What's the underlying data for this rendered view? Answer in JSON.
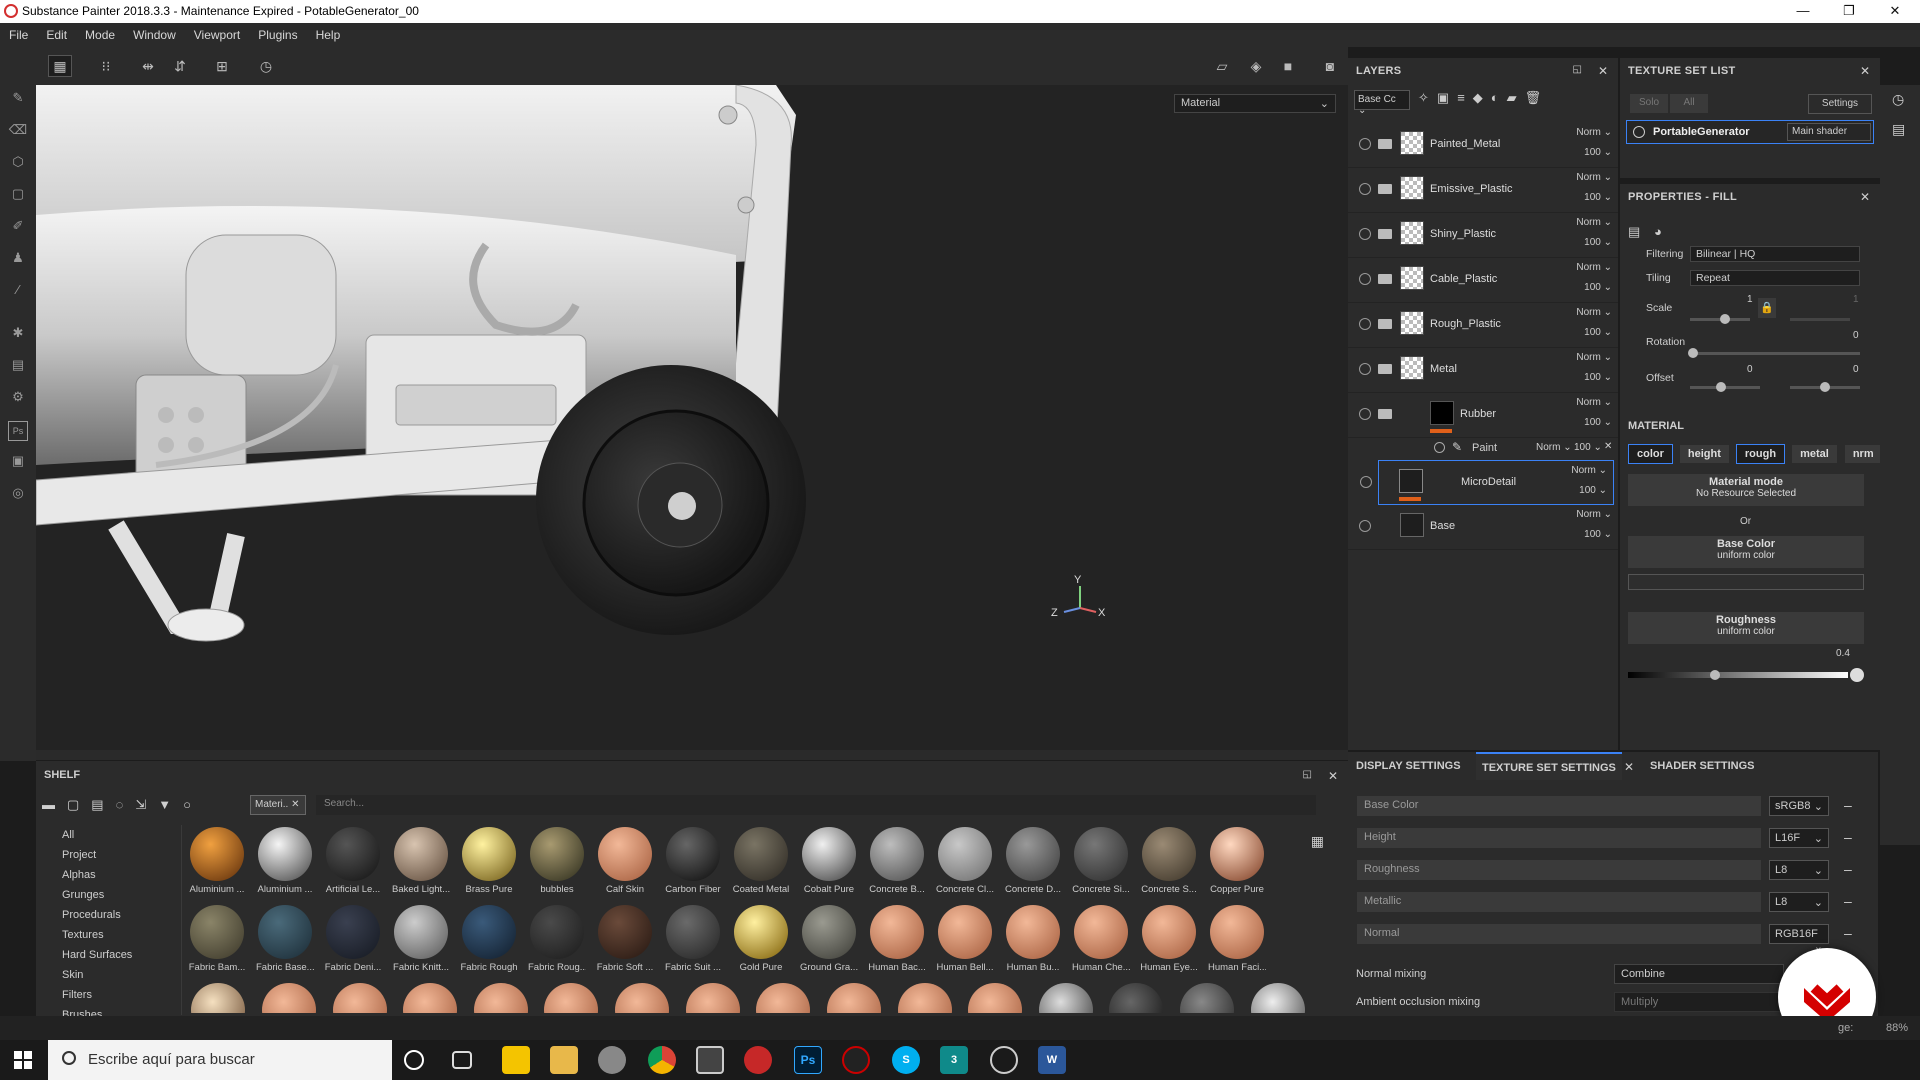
{
  "window": {
    "title": "Substance Painter 2018.3.3 - Maintenance Expired - PotableGenerator_00",
    "controls": [
      "—",
      "❐",
      "✕"
    ]
  },
  "menu": [
    "File",
    "Edit",
    "Mode",
    "Window",
    "Viewport",
    "Plugins",
    "Help"
  ],
  "viewport": {
    "material_select": "Material",
    "axis": {
      "y": "Y",
      "z": "Z",
      "x": "X"
    }
  },
  "layers": {
    "title": "LAYERS",
    "channel": "Base Cc",
    "items": [
      {
        "name": "Painted_Metal",
        "blend": "Norm",
        "opacity": "100"
      },
      {
        "name": "Emissive_Plastic",
        "blend": "Norm",
        "opacity": "100"
      },
      {
        "name": "Shiny_Plastic",
        "blend": "Norm",
        "opacity": "100"
      },
      {
        "name": "Cable_Plastic",
        "blend": "Norm",
        "opacity": "100"
      },
      {
        "name": "Rough_Plastic",
        "blend": "Norm",
        "opacity": "100"
      },
      {
        "name": "Metal",
        "blend": "Norm",
        "opacity": "100"
      },
      {
        "name": "Rubber",
        "blend": "Norm",
        "opacity": "100"
      }
    ],
    "paint": {
      "name": "Paint",
      "blend": "Norm",
      "opacity": "100"
    },
    "microdetail": {
      "name": "MicroDetail",
      "blend": "Norm",
      "opacity": "100"
    },
    "base": {
      "name": "Base",
      "blend": "Norm",
      "opacity": "100"
    }
  },
  "texture_set_list": {
    "title": "TEXTURE SET LIST",
    "solo": "Solo",
    "all": "All",
    "settings": "Settings",
    "set_name": "PortableGenerator",
    "shader": "Main shader"
  },
  "properties": {
    "title": "PROPERTIES - FILL",
    "filtering_label": "Filtering",
    "filtering": "Bilinear | HQ",
    "tiling_label": "Tiling",
    "tiling": "Repeat",
    "scale_label": "Scale",
    "scale_val": "1",
    "scale_val2": "1",
    "rotation_label": "Rotation",
    "rotation_val": "0",
    "offset_label": "Offset",
    "offset_val1": "0",
    "offset_val2": "0",
    "material_title": "MATERIAL",
    "channels": [
      "color",
      "height",
      "rough",
      "metal",
      "nrm"
    ],
    "material_mode": "Material mode",
    "no_resource": "No Resource Selected",
    "or": "Or",
    "base_color": "Base Color",
    "uniform1": "uniform color",
    "roughness": "Roughness",
    "uniform2": "uniform color",
    "rough_value": "0.4"
  },
  "bottom_tabs": [
    "DISPLAY SETTINGS",
    "TEXTURE SET SETTINGS",
    "SHADER SETTINGS"
  ],
  "texset": {
    "rows": [
      {
        "name": "Base Color",
        "fmt": "sRGB8"
      },
      {
        "name": "Height",
        "fmt": "L16F"
      },
      {
        "name": "Roughness",
        "fmt": "L8"
      },
      {
        "name": "Metallic",
        "fmt": "L8"
      },
      {
        "name": "Normal",
        "fmt": "RGB16F"
      }
    ],
    "normal_mixing_label": "Normal mixing",
    "normal_mixing": "Combine",
    "ao_label": "Ambient occlusion mixing",
    "ao": "Multiply"
  },
  "shelf": {
    "title": "SHELF",
    "filter_chip": "Materi..",
    "search_placeholder": "Search...",
    "categories": [
      "All",
      "Project",
      "Alphas",
      "Grunges",
      "Procedurals",
      "Textures",
      "Hard Surfaces",
      "Skin",
      "Filters",
      "Brushes"
    ],
    "row1": [
      {
        "name": "Aluminium ...",
        "c1": "#f0a040",
        "c2": "#5a2a08"
      },
      {
        "name": "Aluminium ...",
        "c1": "#f5f5f5",
        "c2": "#404040"
      },
      {
        "name": "Artificial Le...",
        "c1": "#555",
        "c2": "#111"
      },
      {
        "name": "Baked Light...",
        "c1": "#d8c4b0",
        "c2": "#5a4636"
      },
      {
        "name": "Brass Pure",
        "c1": "#fff2a0",
        "c2": "#6a5410"
      },
      {
        "name": "bubbles",
        "c1": "#a89a70",
        "c2": "#2a2a1a"
      },
      {
        "name": "Calf Skin",
        "c1": "#f2b898",
        "c2": "#a25a3a"
      },
      {
        "name": "Carbon Fiber",
        "c1": "#666",
        "c2": "#0a0a0a"
      },
      {
        "name": "Coated Metal",
        "c1": "#7a7464",
        "c2": "#2a2620"
      },
      {
        "name": "Cobalt Pure",
        "c1": "#f0f0f0",
        "c2": "#3a3a3a"
      },
      {
        "name": "Concrete B...",
        "c1": "#bdbdbd",
        "c2": "#4a4a4a"
      },
      {
        "name": "Concrete Cl...",
        "c1": "#c8c8c8",
        "c2": "#6a6a6a"
      },
      {
        "name": "Concrete D...",
        "c1": "#999",
        "c2": "#3a3a3a"
      },
      {
        "name": "Concrete Si...",
        "c1": "#777",
        "c2": "#2a2a2a"
      },
      {
        "name": "Concrete S...",
        "c1": "#9a8a74",
        "c2": "#3a3226"
      },
      {
        "name": "Copper Pure",
        "c1": "#ffd8c0",
        "c2": "#7a3a20"
      }
    ],
    "row2": [
      {
        "name": "Fabric Bam...",
        "c1": "#8a8468",
        "c2": "#3a3628"
      },
      {
        "name": "Fabric Base...",
        "c1": "#4a6a7a",
        "c2": "#1a2a34"
      },
      {
        "name": "Fabric Deni...",
        "c1": "#3a4050",
        "c2": "#141820"
      },
      {
        "name": "Fabric Knitt...",
        "c1": "#ccc",
        "c2": "#555"
      },
      {
        "name": "Fabric Rough",
        "c1": "#3a5a7a",
        "c2": "#101c2a"
      },
      {
        "name": "Fabric Roug...",
        "c1": "#4a4a4a",
        "c2": "#1a1a1a"
      },
      {
        "name": "Fabric Soft ...",
        "c1": "#6a4a3a",
        "c2": "#241610"
      },
      {
        "name": "Fabric Suit ...",
        "c1": "#6a6a6a",
        "c2": "#222"
      },
      {
        "name": "Gold Pure",
        "c1": "#fff0a0",
        "c2": "#7a5a00"
      },
      {
        "name": "Ground Gra...",
        "c1": "#9a9a90",
        "c2": "#3a3a34"
      },
      {
        "name": "Human Bac...",
        "c1": "#f2b898",
        "c2": "#a25a3a"
      },
      {
        "name": "Human Bell...",
        "c1": "#f2b898",
        "c2": "#a25a3a"
      },
      {
        "name": "Human Bu...",
        "c1": "#f2b898",
        "c2": "#a25a3a"
      },
      {
        "name": "Human Che...",
        "c1": "#f2b898",
        "c2": "#a25a3a"
      },
      {
        "name": "Human Eye...",
        "c1": "#f2b898",
        "c2": "#a25a3a"
      },
      {
        "name": "Human Faci...",
        "c1": "#f2b898",
        "c2": "#a25a3a"
      }
    ]
  },
  "statusbar": {
    "zoom_label": "ge:",
    "zoom": "88%"
  },
  "taskbar": {
    "search": "Escribe aquí para buscar"
  }
}
